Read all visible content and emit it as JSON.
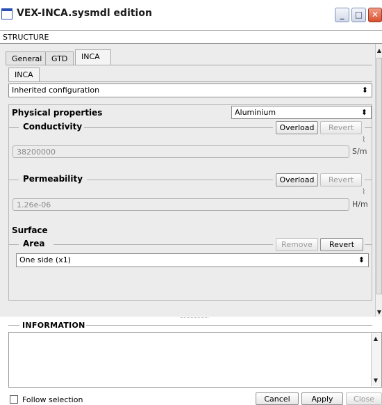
{
  "window": {
    "title": "VEX-INCA.sysmdl edition",
    "minimize_glyph": "_",
    "maximize_glyph": "□",
    "close_glyph": "✕"
  },
  "structure_label": "STRUCTURE",
  "tabs": [
    {
      "label": "General"
    },
    {
      "label": "GTD"
    },
    {
      "label": "INCA"
    }
  ],
  "subtab": {
    "label": "INCA"
  },
  "configuration": {
    "value": "Inherited configuration"
  },
  "physical_properties": {
    "heading": "Physical properties",
    "material": "Aluminium"
  },
  "conductivity": {
    "heading": "Conductivity",
    "overload_label": "Overload",
    "revert_label": "Revert",
    "value": "38200000",
    "unit": "S/m"
  },
  "permeability": {
    "heading": "Permeability",
    "overload_label": "Overload",
    "revert_label": "Revert",
    "value": "1.26e-06",
    "unit": "H/m"
  },
  "surface": {
    "heading": "Surface",
    "area_heading": "Area",
    "remove_label": "Remove",
    "revert_label": "Revert",
    "area_value": "One  side (x1)"
  },
  "information": {
    "heading": "INFORMATION"
  },
  "footer": {
    "follow_label": "Follow selection",
    "cancel_label": "Cancel",
    "apply_label": "Apply",
    "close_label": "Close"
  },
  "colors": {
    "title_accent": "#2b4fb4",
    "close_button": "#d8502f",
    "panel_bg": "#ececec"
  }
}
